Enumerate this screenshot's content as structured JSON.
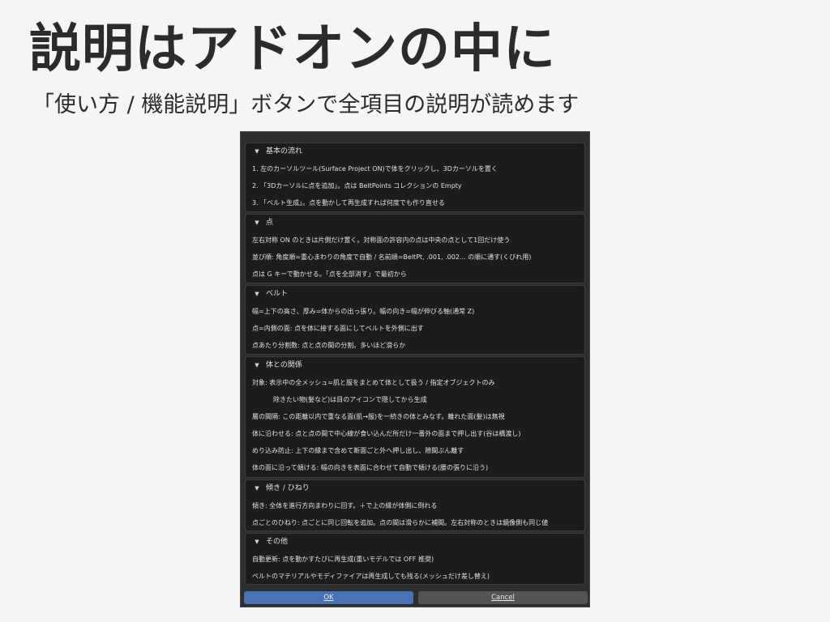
{
  "slide": {
    "title": "説明はアドオンの中に",
    "subtitle": "「使い方 / 機能説明」ボタンで全項目の説明が読めます"
  },
  "dialog": {
    "sections": [
      {
        "title": "基本の流れ",
        "rows": [
          "1. 左のカーソルツール(Surface Project ON)で体をクリックし、3Dカーソルを置く",
          "2. 「3Dカーソルに点を追加」。点は BeltPoints コレクションの Empty",
          "3. 「ベルト生成」。点を動かして再生成すれば何度でも作り直せる"
        ]
      },
      {
        "title": "点",
        "rows": [
          "左右対称 ON のときは片側だけ置く。対称面の許容内の点は中央の点として1回だけ使う",
          "並び順: 角度順=重心まわりの角度で自動 / 名前順=BeltPt, .001, .002... の順に通す(くびれ用)",
          "点は G キーで動かせる。「点を全部消す」で最初から"
        ]
      },
      {
        "title": "ベルト",
        "rows": [
          "幅=上下の高さ、厚み=体からの出っ張り。幅の向き=幅が伸びる軸(通常 Z)",
          "点=内側の面: 点を体に接する面にしてベルトを外側に出す",
          "点あたり分割数: 点と点の間の分割。多いほど滑らか"
        ]
      },
      {
        "title": "体との関係",
        "rows": [
          "対象: 表示中の全メッシュ=肌と服をまとめて体として扱う / 指定オブジェクトのみ",
          "除きたい物(髪など)は目のアイコンで隠してから生成",
          "層の間隔: この距離以内で重なる面(肌→服)を一続きの体とみなす。離れた面(髪)は無視",
          "体に沿わせる: 点と点の間で中心線が食い込んだ所だけ一番外の面まで押し出す(谷は橋渡し)",
          "めり込み防止: 上下の縁まで含めて断面ごと外へ押し出し、隙間ぶん離す",
          "体の面に沿って傾ける: 幅の向きを表面に合わせて自動で傾ける(腰の張りに沿う)"
        ]
      },
      {
        "title": "傾き / ひねり",
        "rows": [
          "傾き: 全体を進行方向まわりに回す。＋で上の縁が体側に倒れる",
          "点ごとのひねり: 点ごとに同じ回転を追加。点の間は滑らかに補間。左右対称のときは鏡像側も同じ値"
        ]
      },
      {
        "title": "その他",
        "rows": [
          "自動更新: 点を動かすたびに再生成(重いモデルでは OFF 推奨)",
          "ベルトのマテリアルやモディファイアは再生成しても残る(メッシュだけ差し替え)"
        ]
      }
    ],
    "ok_label": "OK",
    "cancel_label": "Cancel"
  }
}
